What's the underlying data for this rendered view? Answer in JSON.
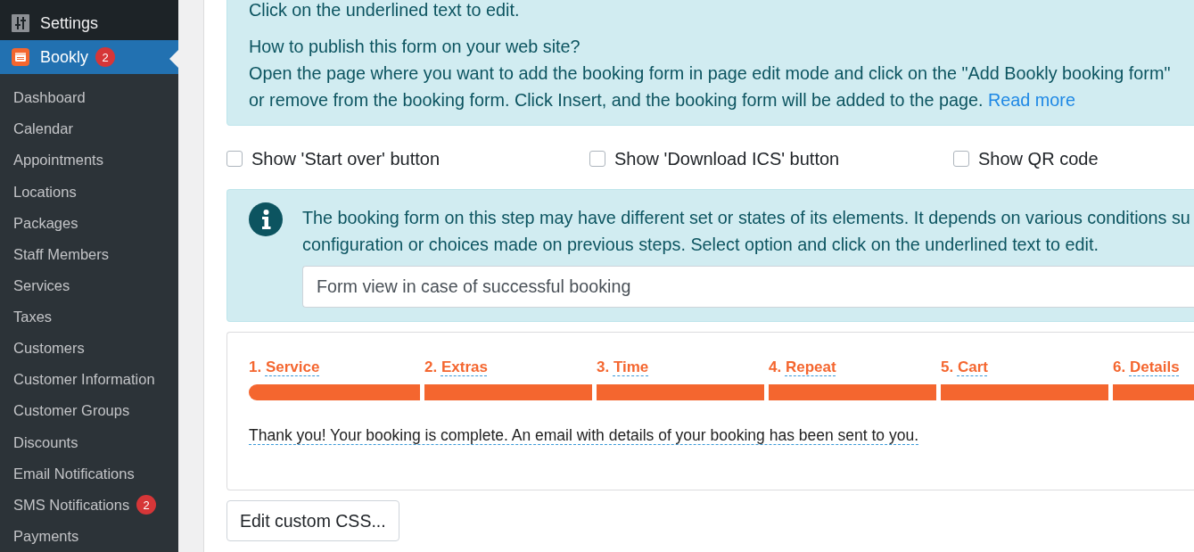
{
  "sidebar": {
    "menu": [
      {
        "label": "Settings",
        "selected": false
      },
      {
        "label": "Bookly",
        "badge": "2",
        "selected": true
      }
    ],
    "submenu": [
      {
        "label": "Dashboard",
        "selected": false
      },
      {
        "label": "Calendar",
        "selected": false
      },
      {
        "label": "Appointments",
        "selected": false
      },
      {
        "label": "Locations",
        "selected": false
      },
      {
        "label": "Packages",
        "selected": false
      },
      {
        "label": "Staff Members",
        "selected": false
      },
      {
        "label": "Services",
        "selected": false
      },
      {
        "label": "Taxes",
        "selected": false
      },
      {
        "label": "Customers",
        "selected": false
      },
      {
        "label": "Customer Information",
        "selected": false
      },
      {
        "label": "Customer Groups",
        "selected": false
      },
      {
        "label": "Discounts",
        "selected": false
      },
      {
        "label": "Email Notifications",
        "selected": false
      },
      {
        "label": "SMS Notifications",
        "badge": "2",
        "selected": false
      },
      {
        "label": "Payments",
        "selected": false
      }
    ]
  },
  "help_box": {
    "note": "Click on the underlined text to edit.",
    "heading": "How to publish this form on your web site?",
    "lines": [
      "Open the page where you want to add the booking form in page edit mode and click on the \"Add Bookly booking form\"",
      "or remove from the booking form. Click Insert, and the booking form will be added to the page."
    ],
    "link": "Read more"
  },
  "options": [
    {
      "label": "Show 'Start over' button",
      "checked": false
    },
    {
      "label": "Show 'Download ICS' button",
      "checked": false
    },
    {
      "label": "Show QR code",
      "checked": false
    }
  ],
  "step_notice": {
    "lines": [
      "The booking form on this step may have different set or states of its elements. It depends on various conditions su",
      "configuration or choices made on previous steps. Select option and click on the underlined text to edit."
    ],
    "select": {
      "value": "Form view in case of successful booking"
    }
  },
  "steps": [
    {
      "number": "1.",
      "name": "Service",
      "completed": true
    },
    {
      "number": "2.",
      "name": "Extras",
      "completed": true
    },
    {
      "number": "3.",
      "name": "Time",
      "completed": true
    },
    {
      "number": "4.",
      "name": "Repeat",
      "completed": true
    },
    {
      "number": "5.",
      "name": "Cart",
      "completed": true
    },
    {
      "number": "6.",
      "name": "Details",
      "completed": true
    }
  ],
  "completion_message": "Thank you! Your booking is complete. An email with details of your booking has been sent to you.",
  "edit_css_button": {
    "label": "Edit custom CSS..."
  }
}
